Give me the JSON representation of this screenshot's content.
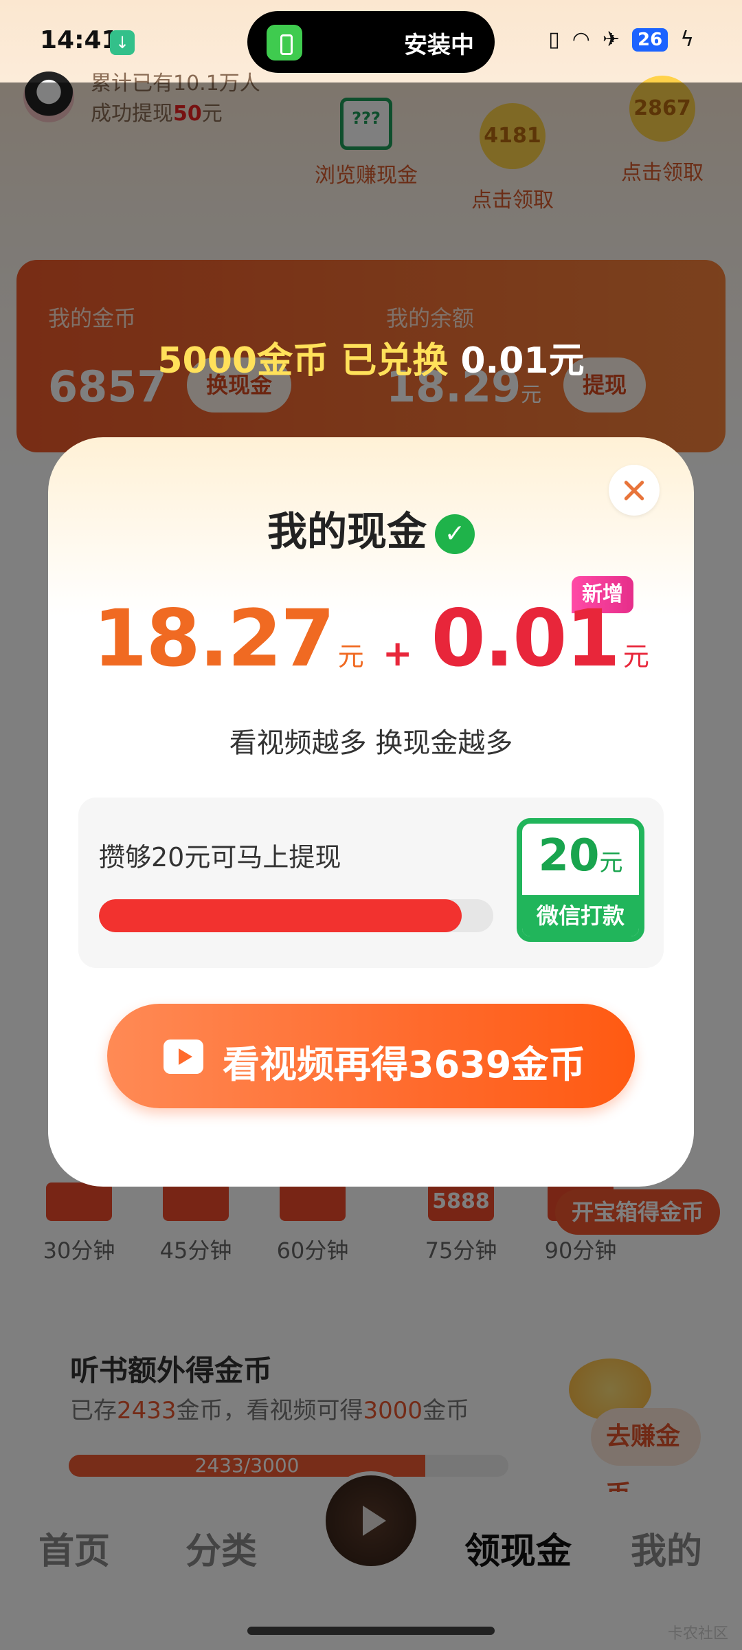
{
  "status_bar": {
    "time": "14:41",
    "island_text": "安装中",
    "battery": "26"
  },
  "header": {
    "cumulative_line1": "累计已有10.1万人",
    "cumulative_line2_prefix": "成功提现",
    "cumulative_amount": "50",
    "cumulative_suffix": "元",
    "browse_icon_text": "???",
    "browse_label": "浏览赚现金",
    "coin_tasks": [
      {
        "value": "4181",
        "label": "点击领取"
      },
      {
        "value": "2867",
        "label": "点击领取"
      }
    ]
  },
  "wallet": {
    "coins_label": "我的金币",
    "coins_value": "6857",
    "exchange_button": "换现金",
    "balance_label": "我的余额",
    "balance_value": "18.29",
    "balance_unit": "元",
    "withdraw_button": "提现"
  },
  "exchange_banner": {
    "text": "5000金币 已兑换 ",
    "amount": "0.01元"
  },
  "background_tasks": [
    {
      "label": "30分钟",
      "box": ""
    },
    {
      "label": "45分钟",
      "box": ""
    },
    {
      "label": "60分钟",
      "box": ""
    },
    {
      "label": "75分钟",
      "box": "5888"
    },
    {
      "label": "90分钟",
      "box": ""
    }
  ],
  "treasure_button": "开宝箱得金币",
  "listen": {
    "title": "听书额外得金币",
    "sub_prefix": "已存",
    "stored": "2433",
    "sub_mid": "金币，看视频可得",
    "reward": "3000",
    "sub_suffix": "金币",
    "progress_text": "2433/3000",
    "progress_fraction": 0.811,
    "earn_button": "去赚金币"
  },
  "tabbar": {
    "tabs": [
      "首页",
      "分类",
      "领现金",
      "我的"
    ],
    "active": "领现金"
  },
  "watermark": "卡农社区",
  "modal": {
    "title": "我的现金",
    "wechat_glyph": "✓",
    "amount_current": "18.27",
    "amount_unit": "元",
    "plus": "+",
    "amount_new": "0.01",
    "new_tag": "新增",
    "subtitle": "看视频越多 换现金越多",
    "progress_label": "攒够20元可马上提现",
    "progress_fraction": 0.92,
    "pay_amount": "20",
    "pay_unit": "元",
    "pay_label": "微信打款",
    "cta_label": "看视频再得3639金币"
  }
}
